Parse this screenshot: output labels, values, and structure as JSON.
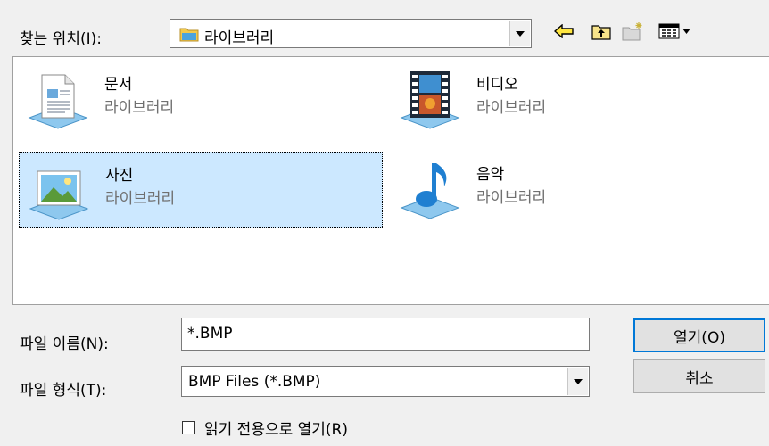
{
  "look_in": {
    "label": "찾는 위치(I):",
    "value": "라이브러리"
  },
  "toolbar": {
    "back_icon": "back-arrow-icon",
    "up_icon": "up-folder-icon",
    "new_folder_icon": "new-folder-icon",
    "views_icon": "views-menu-icon"
  },
  "libraries": [
    {
      "name": "문서",
      "type": "라이브러리",
      "icon": "documents-library-icon"
    },
    {
      "name": "비디오",
      "type": "라이브러리",
      "icon": "videos-library-icon"
    },
    {
      "name": "사진",
      "type": "라이브러리",
      "icon": "pictures-library-icon",
      "selected": true
    },
    {
      "name": "음악",
      "type": "라이브러리",
      "icon": "music-library-icon"
    }
  ],
  "file_name": {
    "label": "파일 이름(N):",
    "value": "*.BMP"
  },
  "file_type": {
    "label": "파일 형식(T):",
    "value": "BMP Files (*.BMP)"
  },
  "buttons": {
    "open": "열기(O)",
    "cancel": "취소"
  },
  "read_only": {
    "label": "읽기 전용으로 열기(R)",
    "checked": false
  },
  "colors": {
    "selection": "#cce8ff",
    "accent": "#0078d7"
  }
}
